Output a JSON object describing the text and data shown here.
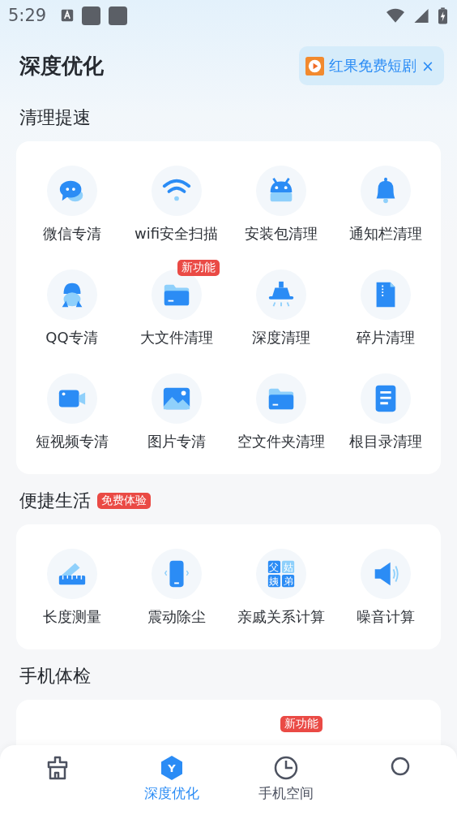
{
  "status_bar": {
    "time": "5:29"
  },
  "header": {
    "title": "深度优化",
    "promo": {
      "label": "红果免费短剧",
      "close": "×"
    }
  },
  "sections": [
    {
      "title": "清理提速",
      "items": [
        {
          "label": "微信专清"
        },
        {
          "label": "wifi安全扫描"
        },
        {
          "label": "安装包清理"
        },
        {
          "label": "通知栏清理"
        },
        {
          "label": "QQ专清"
        },
        {
          "label": "大文件清理",
          "badge": "新功能"
        },
        {
          "label": "深度清理"
        },
        {
          "label": "碎片清理"
        },
        {
          "label": "短视频专清"
        },
        {
          "label": "图片专清"
        },
        {
          "label": "空文件夹清理"
        },
        {
          "label": "根目录清理"
        }
      ]
    },
    {
      "title": "便捷生活",
      "badge": "免费体验",
      "items": [
        {
          "label": "长度测量"
        },
        {
          "label": "震动除尘"
        },
        {
          "label": "亲戚关系计算",
          "glyphs": [
            "父",
            "姑",
            "姨",
            "弟"
          ]
        },
        {
          "label": "噪音计算"
        }
      ]
    },
    {
      "title": "手机体检",
      "badge_in_card": "新功能"
    }
  ],
  "nav": [
    {
      "selected": false
    },
    {
      "label": "深度优化",
      "icon_text": "Y",
      "selected": true
    },
    {
      "label": "手机空间",
      "selected": false
    },
    {
      "selected": false
    }
  ]
}
